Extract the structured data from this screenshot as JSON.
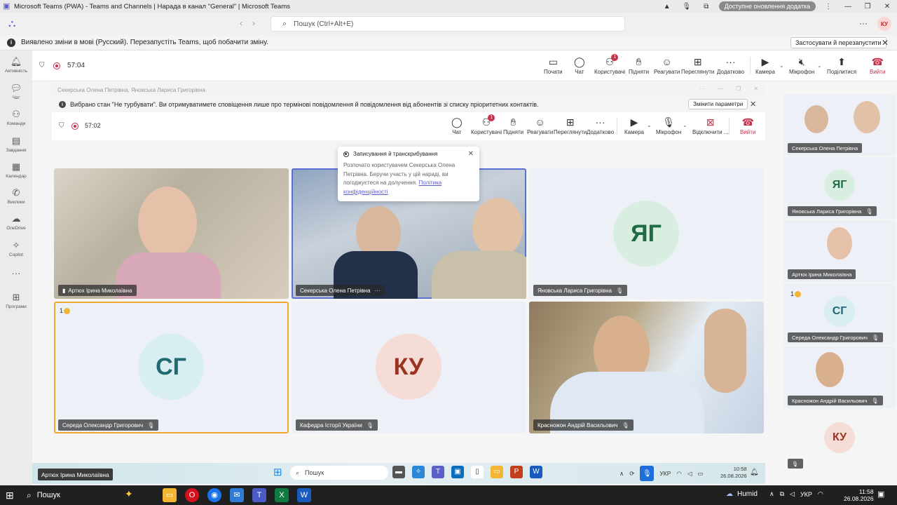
{
  "window": {
    "title": "Microsoft Teams (PWA) - Teams and Channels | Нарада в канал \"General\" | Microsoft Teams",
    "update_pill": "Доступне оновлення додатка"
  },
  "nav": {
    "search_placeholder": "Пошук (Ctrl+Alt+E)",
    "avatar": "КУ"
  },
  "infobar": {
    "text": "Виявлено зміни в мові (Русский). Перезапустіть Teams, щоб побачити зміну.",
    "button": "Застосувати й перезапустити"
  },
  "rail": [
    {
      "label": "Активність",
      "icon": "bell-icon"
    },
    {
      "label": "Чат",
      "icon": "chat-icon"
    },
    {
      "label": "Команди",
      "icon": "teams-icon"
    },
    {
      "label": "Завдання",
      "icon": "tasks-icon"
    },
    {
      "label": "Календар",
      "icon": "calendar-icon"
    },
    {
      "label": "Виклики",
      "icon": "phone-icon"
    },
    {
      "label": "OneDrive",
      "icon": "cloud-icon"
    },
    {
      "label": "Copilot",
      "icon": "copilot-icon"
    },
    {
      "label": "Програми",
      "icon": "apps-icon"
    }
  ],
  "meeting": {
    "timer": "57:04",
    "buttons": {
      "start": "Почати",
      "chat": "Чат",
      "people": "Користувачі",
      "people_badge": "1",
      "raise": "Підняти",
      "react": "Реагувати",
      "view": "Переглянути",
      "more": "Додатково",
      "camera": "Камера",
      "mic": "Мікрофон",
      "share": "Поділитися",
      "leave": "Вийти"
    }
  },
  "inner": {
    "title": "Секерська Олена Петрівна, Яновська Лариса Григорівна",
    "dnd_text": "Вибрано стан \"Не турбувати\". Ви отримуватимете сповіщення лише про термінові повідомлення й повідомлення від абонентів зі списку пріоритетних контактів.",
    "dnd_button": "Змінити параметри",
    "timer": "57:02",
    "buttons": {
      "chat": "Чат",
      "people": "Користувачі",
      "people_badge": "1",
      "raise": "Підняти",
      "react": "Реагувати",
      "view": "Переглянути",
      "more": "Додатково",
      "camera": "Камера",
      "mic": "Мікрофон",
      "disconnect": "Відключити ...",
      "leave": "Вийти"
    }
  },
  "popup": {
    "title": "Записування й транскрибування",
    "body": "Розпочато користувачем Секерська Олена Петрівна. Беручи участь у цій нараді, ви погоджуєтеся на долучення.",
    "link": "Політика конфіденційності"
  },
  "tiles": [
    {
      "name": "Артюх Ірина Миколаївна"
    },
    {
      "name": "Секерська Олена Петрівна"
    },
    {
      "name": "Яновська Лариса Григорівна",
      "initials": "ЯГ"
    },
    {
      "name": "Середа Олександр Григорович",
      "initials": "СГ",
      "hand": "1"
    },
    {
      "name": "Кафедра Історії України",
      "initials": "КУ"
    },
    {
      "name": "Красножон Андрій Васильович"
    }
  ],
  "right": [
    {
      "name": "Секерська Олена Петрівна"
    },
    {
      "name": "Яновська Лариса Григорівна",
      "initials": "ЯГ"
    },
    {
      "name": "Артюх Ірина Миколаївна"
    },
    {
      "name": "Середа Олександр Григорович",
      "initials": "СГ",
      "hand": "1"
    },
    {
      "name": "Красножон Андрій Васильович"
    },
    {
      "initials": "КУ"
    }
  ],
  "inner_taskbar": {
    "tooltip": "Артюх Ірина Миколаївна",
    "search": "Пошук",
    "lang": "УКР",
    "time": "10:58",
    "date": "26.08.2026"
  },
  "taskbar": {
    "search": "Пошук",
    "weather": "Humid",
    "lang": "УКР",
    "time": "11:58",
    "date": "26.08.2026"
  },
  "colors": {
    "accent": "#5b5fc7",
    "leave": "#c4314b",
    "selected_blue": "#5b6fd6",
    "hand_gold": "#f0a830"
  }
}
